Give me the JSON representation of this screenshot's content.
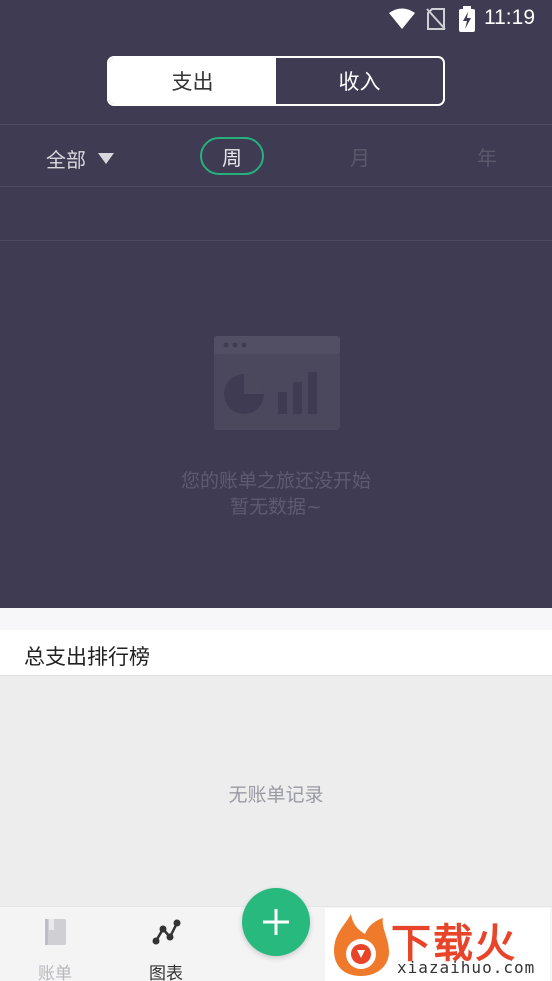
{
  "status_bar": {
    "time": "11:19"
  },
  "toggle": {
    "expense": "支出",
    "income": "收入",
    "selected": "支出"
  },
  "filter": {
    "category": "全部",
    "periods": [
      "周",
      "月",
      "年"
    ],
    "selected_period": "周"
  },
  "empty_state": {
    "line1": "您的账单之旅还没开始",
    "line2": "暂无数据~"
  },
  "ranking": {
    "title": "总支出排行榜",
    "empty": "无账单记录"
  },
  "bottom_nav": {
    "bills": "账单",
    "chart": "图表",
    "selected": "图表"
  },
  "watermark": {
    "text": "下载火",
    "url": "xiazaihuo.com"
  },
  "colors": {
    "header_bg": "#3f3b52",
    "accent": "#27b97d",
    "brand": "#e8442a"
  }
}
